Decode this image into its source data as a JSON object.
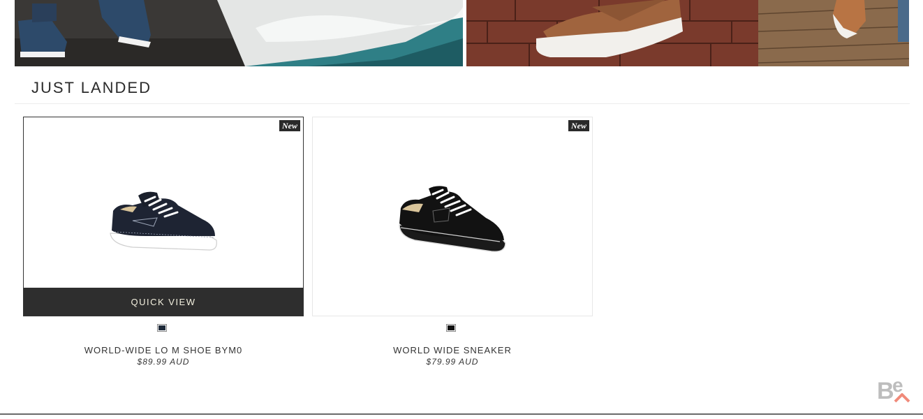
{
  "section": {
    "title": "JUST LANDED"
  },
  "products": [
    {
      "name": "WORLD-WIDE LO M SHOE BYM0",
      "price": "$89.99 AUD",
      "badge": "New",
      "quick_view_label": "QUICK VIEW",
      "swatch_color": "#1f2a3a",
      "shoe_upper_color": "#1e2433",
      "sole_color": "#ffffff"
    },
    {
      "name": "WORLD WIDE SNEAKER",
      "price": "$79.99 AUD",
      "badge": "New",
      "swatch_color": "#111111",
      "shoe_upper_color": "#121212",
      "sole_color": "#1a1a1a"
    }
  ],
  "colors": {
    "quick_view_bg": "#2e2e2e",
    "badge_bg": "#2a2a2a",
    "accent_footer": "#6a6a6a"
  }
}
